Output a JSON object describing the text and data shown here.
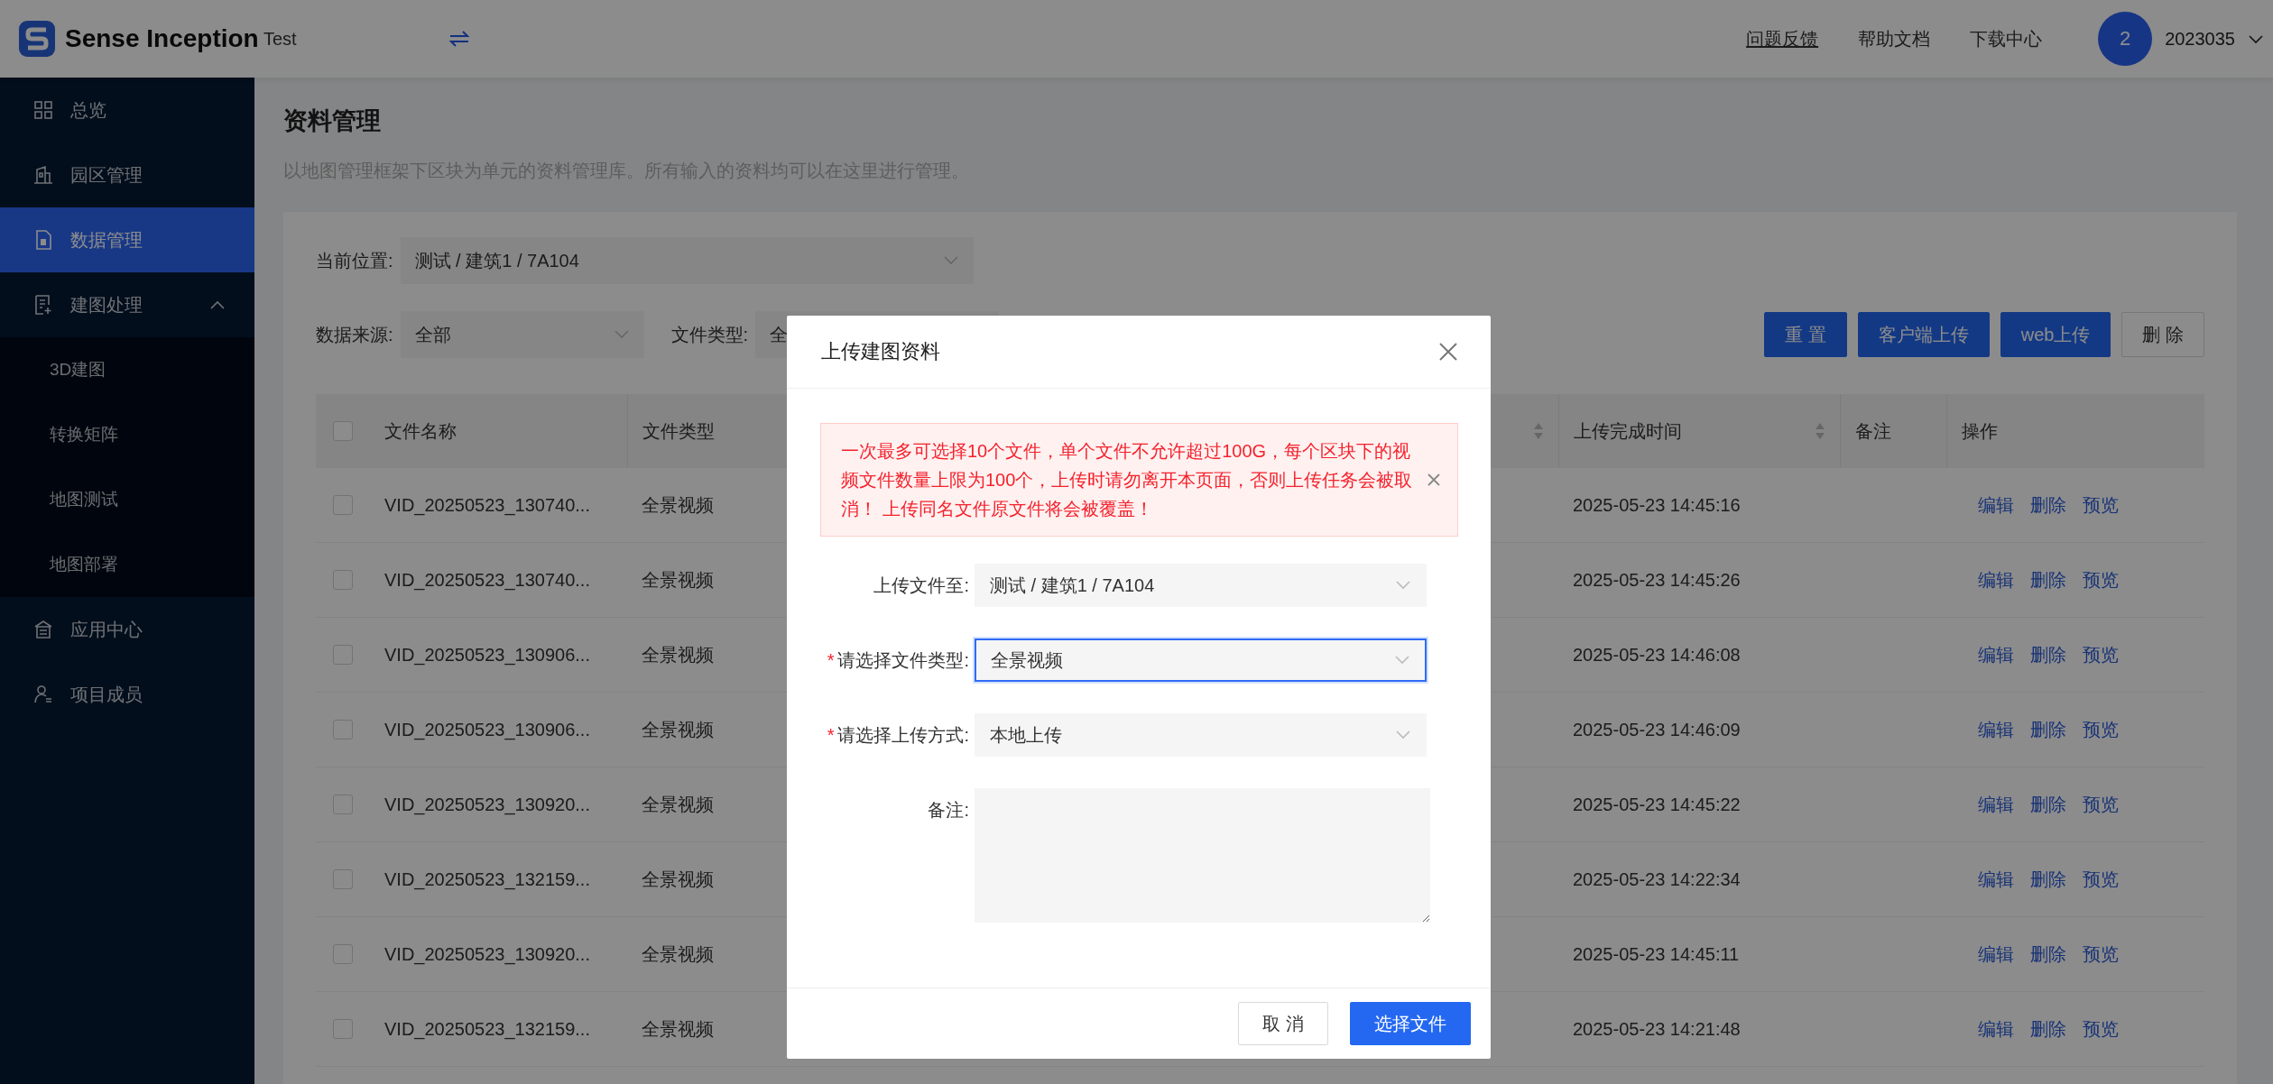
{
  "header": {
    "logo_text": "Sense Inception",
    "project": "Test",
    "links": [
      {
        "label": "问题反馈",
        "underlined": true
      },
      {
        "label": "帮助文档",
        "underlined": false
      },
      {
        "label": "下载中心",
        "underlined": false
      }
    ],
    "user": {
      "avatar": "2",
      "name": "2023035"
    }
  },
  "sidebar": {
    "items": [
      {
        "label": "总览",
        "selected": false
      },
      {
        "label": "园区管理",
        "selected": false
      },
      {
        "label": "数据管理",
        "selected": true
      },
      {
        "label": "建图处理",
        "selected": false,
        "expanded": true,
        "children": [
          {
            "label": "3D建图",
            "selected": false
          },
          {
            "label": "转换矩阵",
            "selected": false
          },
          {
            "label": "地图测试",
            "selected": false
          },
          {
            "label": "地图部署",
            "selected": false
          }
        ]
      },
      {
        "label": "应用中心",
        "selected": false
      },
      {
        "label": "项目成员",
        "selected": false
      }
    ]
  },
  "page": {
    "title": "资料管理",
    "description": "以地图管理框架下区块为单元的资料管理库。所有输入的资料均可以在这里进行管理。"
  },
  "filters": {
    "location": {
      "label": "当前位置:",
      "value": "测试 / 建筑1 / 7A104"
    },
    "source": {
      "label": "数据来源:",
      "value": "全部"
    },
    "file_type": {
      "label": "文件类型:",
      "value": "全"
    }
  },
  "buttons": [
    {
      "label": "重 置",
      "kind": "primary"
    },
    {
      "label": "客户端上传",
      "kind": "primary"
    },
    {
      "label": "web上传",
      "kind": "primary"
    },
    {
      "label": "删 除",
      "kind": "default"
    }
  ],
  "table": {
    "select_all": false,
    "columns": [
      {
        "label": "文件名称"
      },
      {
        "label": "文件类型"
      },
      {
        "sortable": true
      },
      {
        "label": "上传完成时间",
        "sortable": true
      },
      {
        "label": "备注"
      },
      {
        "label": "操作"
      }
    ],
    "rows": [
      {
        "checked": false,
        "name": "VID_20250523_130740...",
        "type": "全景视频",
        "finished": "2025-05-23 14:45:16",
        "actions": [
          "编辑",
          "删除",
          "预览"
        ]
      },
      {
        "checked": false,
        "name": "VID_20250523_130740...",
        "type": "全景视频",
        "finished": "2025-05-23 14:45:26",
        "actions": [
          "编辑",
          "删除",
          "预览"
        ]
      },
      {
        "checked": false,
        "name": "VID_20250523_130906...",
        "type": "全景视频",
        "finished": "2025-05-23 14:46:08",
        "actions": [
          "编辑",
          "删除",
          "预览"
        ]
      },
      {
        "checked": false,
        "name": "VID_20250523_130906...",
        "type": "全景视频",
        "finished": "2025-05-23 14:46:09",
        "actions": [
          "编辑",
          "删除",
          "预览"
        ]
      },
      {
        "checked": false,
        "name": "VID_20250523_130920...",
        "type": "全景视频",
        "finished": "2025-05-23 14:45:22",
        "actions": [
          "编辑",
          "删除",
          "预览"
        ]
      },
      {
        "checked": false,
        "name": "VID_20250523_132159...",
        "type": "全景视频",
        "finished": "2025-05-23 14:22:34",
        "actions": [
          "编辑",
          "删除",
          "预览"
        ]
      },
      {
        "checked": false,
        "name": "VID_20250523_130920...",
        "type": "全景视频",
        "finished": "2025-05-23 14:45:11",
        "actions": [
          "编辑",
          "删除",
          "预览"
        ]
      },
      {
        "checked": false,
        "name": "VID_20250523_132159...",
        "type": "全景视频",
        "finished": "2025-05-23 14:21:48",
        "actions": [
          "编辑",
          "删除",
          "预览"
        ]
      }
    ]
  },
  "modal": {
    "title": "上传建图资料",
    "alert": {
      "text": "一次最多可选择10个文件，单个文件不允许超过100G，每个区块下的视频文件数量上限为100个，上传时请勿离开本页面，否则上传任务会被取消！ 上传同名文件原文件将会被覆盖！",
      "closable": true
    },
    "fields": [
      {
        "kind": "select",
        "label": "上传文件至:",
        "focused": false,
        "value": "测试 / 建筑1 / 7A104"
      },
      {
        "kind": "select",
        "required_mark": "*",
        "label": "请选择文件类型:",
        "focused": true,
        "value": "全景视频"
      },
      {
        "kind": "select",
        "required_mark": "*",
        "label": "请选择上传方式:",
        "focused": false,
        "value": "本地上传"
      },
      {
        "kind": "textarea",
        "label": "备注:",
        "focused": false
      }
    ],
    "buttons": [
      {
        "label": "取 消",
        "kind": "default"
      },
      {
        "label": "选择文件",
        "kind": "primary"
      }
    ]
  }
}
